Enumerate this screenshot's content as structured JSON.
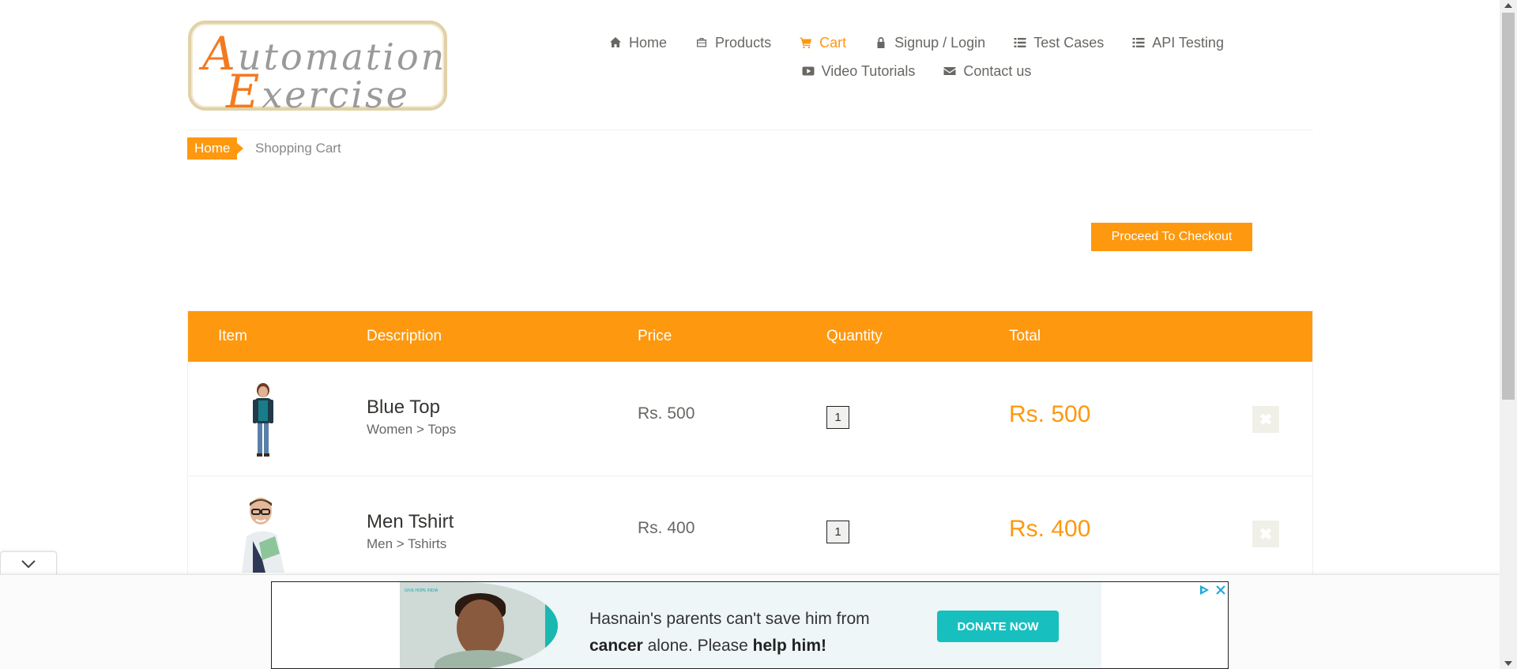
{
  "logo": {
    "line1_cap": "A",
    "line1_rest": "utomation",
    "line2_cap": "E",
    "line2_rest": "xercise"
  },
  "nav": {
    "items": [
      {
        "label": "Home",
        "icon": "home-icon",
        "active": false
      },
      {
        "label": "Products",
        "icon": "briefcase-icon",
        "active": false
      },
      {
        "label": "Cart",
        "icon": "cart-icon",
        "active": true
      },
      {
        "label": "Signup / Login",
        "icon": "lock-icon",
        "active": false
      },
      {
        "label": "Test Cases",
        "icon": "list-icon",
        "active": false
      },
      {
        "label": "API Testing",
        "icon": "list-icon",
        "active": false
      },
      {
        "label": "Video Tutorials",
        "icon": "youtube-icon",
        "active": false
      },
      {
        "label": "Contact us",
        "icon": "envelope-icon",
        "active": false
      }
    ]
  },
  "breadcrumb": {
    "home": "Home",
    "current": "Shopping Cart"
  },
  "checkout": {
    "label": "Proceed To Checkout"
  },
  "cart": {
    "headers": {
      "item": "Item",
      "description": "Description",
      "price": "Price",
      "quantity": "Quantity",
      "total": "Total"
    },
    "rows": [
      {
        "name": "Blue Top",
        "category": "Women > Tops",
        "price": "Rs. 500",
        "quantity": "1",
        "total": "Rs. 500"
      },
      {
        "name": "Men Tshirt",
        "category": "Men > Tshirts",
        "price": "Rs. 400",
        "quantity": "1",
        "total": "Rs. 400"
      }
    ]
  },
  "ad": {
    "org": "GIVE HOPE INDIA",
    "text_part1": "Hasnain's parents can't save him from",
    "text_bold1": "cancer",
    "text_part2": "alone. Please",
    "text_bold2": "help him!",
    "button": "DONATE NOW"
  },
  "colors": {
    "accent": "#fe980f",
    "ad_button": "#18bfbf",
    "text": "#696763"
  }
}
